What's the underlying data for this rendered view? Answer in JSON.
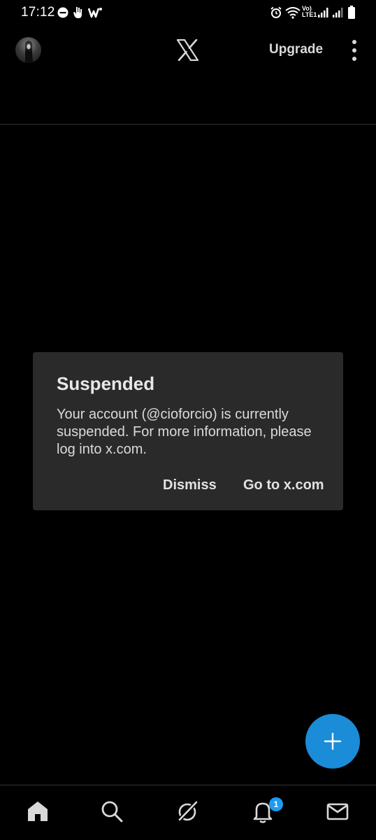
{
  "status_bar": {
    "time": "17:12",
    "network_label": "Vo) LTE1"
  },
  "header": {
    "upgrade_label": "Upgrade"
  },
  "dialog": {
    "title": "Suspended",
    "message": "Your account (@cioforcio) is currently suspended. For more information, please log into x.com.",
    "dismiss_label": "Dismiss",
    "goto_label": "Go to x.com"
  },
  "bottom_nav": {
    "items": [
      "home-icon",
      "search-icon",
      "grok-icon",
      "notifications-icon",
      "messages-icon"
    ],
    "notifications_badge": "1"
  },
  "fab": {
    "icon": "plus-icon",
    "color": "#1a8cd8"
  },
  "colors": {
    "background": "#000000",
    "dialog_bg": "#2a2a2a",
    "accent": "#1d9bf0"
  }
}
